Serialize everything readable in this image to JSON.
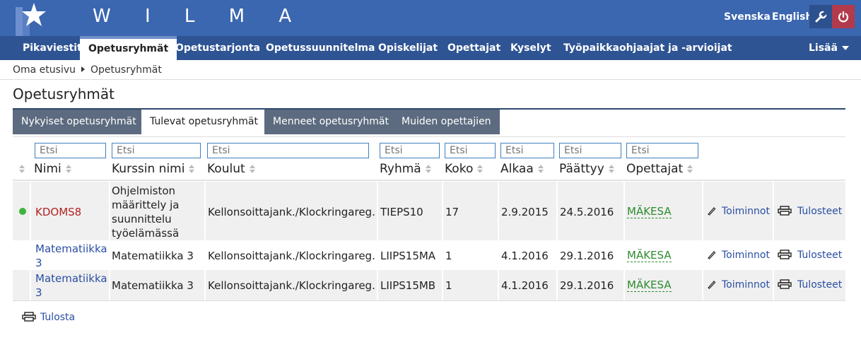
{
  "app": {
    "brand": "W I L M A"
  },
  "header": {
    "lang_sv": "Svenska",
    "lang_en": "English"
  },
  "nav": {
    "items": [
      "Pikaviestit",
      "Opetusryhmät",
      "Opetustarjonta",
      "Opetussuunnitelma",
      "Opiskelijat",
      "Opettajat",
      "Kyselyt",
      "Työpaikkaohjaajat ja -arvioijat"
    ],
    "active": "Opetusryhmät",
    "more": "Lisää"
  },
  "breadcrumb": [
    "Oma etusivu",
    "Opetusryhmät"
  ],
  "page": {
    "title": "Opetusryhmät"
  },
  "tabs": [
    "Nykyiset opetusryhmät",
    "Tulevat opetusryhmät",
    "Menneet opetusryhmät",
    "Muiden opettajien"
  ],
  "active_tab": "Tulevat opetusryhmät",
  "filter_placeholder": "Etsi",
  "columns": [
    "Nimi",
    "Kurssin nimi",
    "Koulut",
    "Ryhmä",
    "Koko",
    "Alkaa",
    "Päättyy",
    "Opettajat"
  ],
  "rows": [
    {
      "name": "KDOMS8",
      "course": [
        "Ohjelmiston",
        "määrittely ja",
        "suunnittelu",
        "työelämässä"
      ],
      "school": "Kellonsoittajank./Klockringareg.",
      "group": "TIEPS10",
      "size": "17",
      "start": "2.9.2015",
      "end": "24.5.2016",
      "teacher": "MÄKESA",
      "actions": "Toiminnot",
      "prints": "Tulosteet",
      "status": "active"
    },
    {
      "name": [
        "Matematiikka",
        "3"
      ],
      "course": [
        "Matematiikka 3"
      ],
      "school": "Kellonsoittajank./Klockringareg.",
      "group": "LIIPS15MA",
      "size": "1",
      "start": "4.1.2016",
      "end": "29.1.2016",
      "teacher": "MÄKESA",
      "actions": "Toiminnot",
      "prints": "Tulosteet"
    },
    {
      "name": [
        "Matematiikka",
        "3"
      ],
      "course": [
        "Matematiikka 3"
      ],
      "school": "Kellonsoittajank./Klockringareg.",
      "group": "LIIPS15MB",
      "size": "1",
      "start": "4.1.2016",
      "end": "29.1.2016",
      "teacher": "MÄKESA",
      "actions": "Toiminnot",
      "prints": "Tulosteet"
    }
  ],
  "print_label": "Tulosta"
}
